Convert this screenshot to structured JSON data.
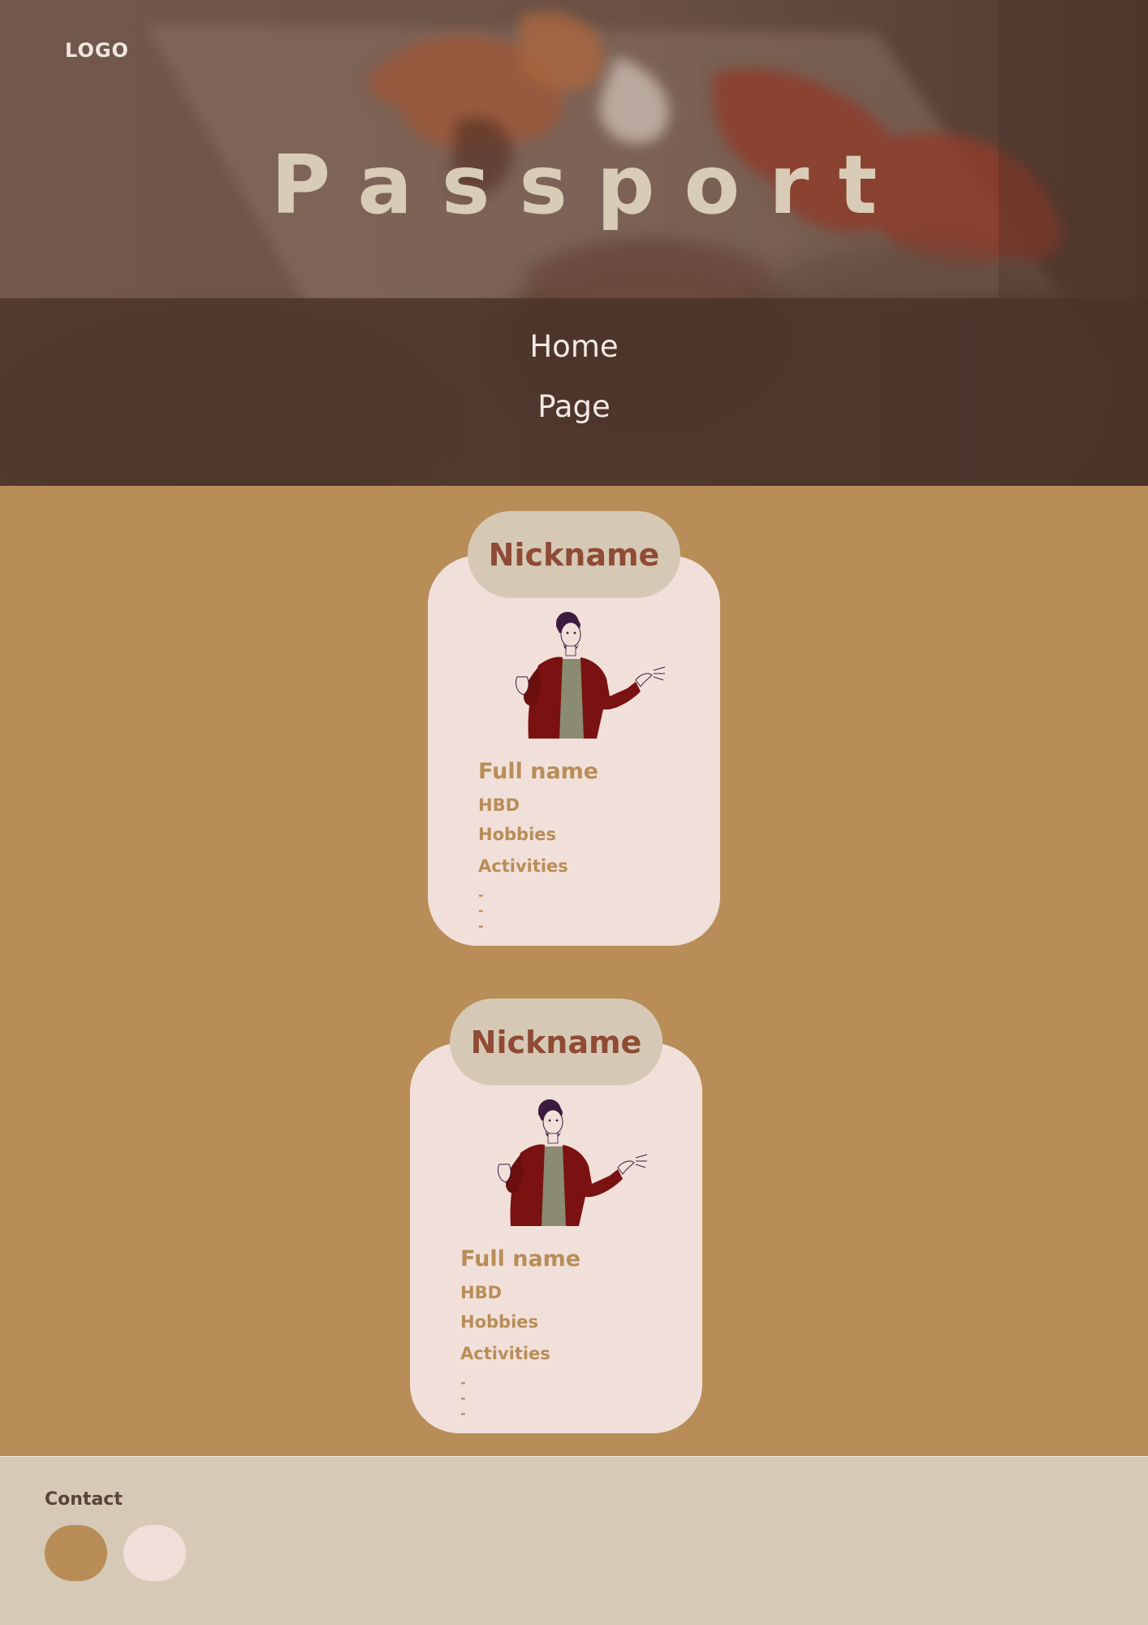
{
  "header": {
    "logo": "LOGO",
    "title": "Passport"
  },
  "nav": {
    "items": [
      {
        "label": "Home"
      },
      {
        "label": "Page"
      }
    ]
  },
  "cards": [
    {
      "nickname": "Nickname",
      "full_name": "Full name",
      "hbd": "HBD",
      "hobbies": "Hobbies",
      "activities": "Activities",
      "activity_items": [
        "-",
        "-",
        "-"
      ],
      "avatar_icon": "person-presenting-illustration"
    },
    {
      "nickname": "Nickname",
      "full_name": "Full name",
      "hbd": "HBD",
      "hobbies": "Hobbies",
      "activities": "Activities",
      "activity_items": [
        "-",
        "-",
        "-"
      ],
      "avatar_icon": "person-presenting-illustration"
    }
  ],
  "footer": {
    "contact_label": "Contact",
    "contact_buttons": [
      {
        "color": "#b88d58"
      },
      {
        "color": "#f1e0da"
      }
    ]
  },
  "colors": {
    "page_bg": "#b88d58",
    "card_bg": "#f1e0da",
    "tab_bg": "#d5c9b5",
    "nickname_text": "#8f4b35",
    "card_text": "#b88d58",
    "footer_bg": "#d6c9b5",
    "hero_overlay": "#4a332a"
  }
}
